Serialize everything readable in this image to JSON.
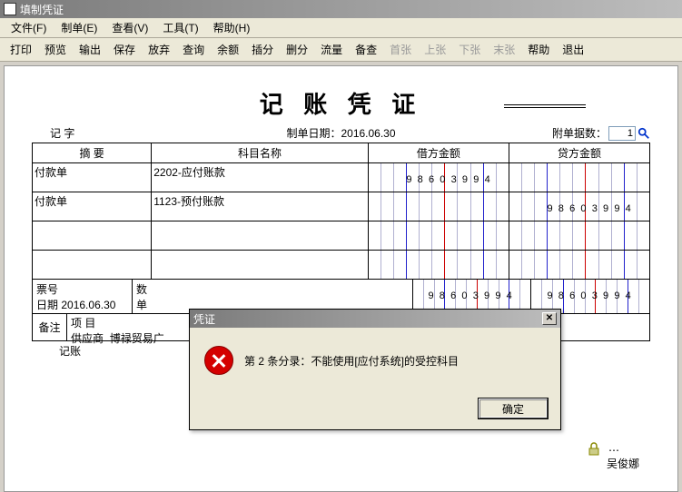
{
  "title": "填制凭证",
  "menubar": [
    "文件(F)",
    "制单(E)",
    "查看(V)",
    "工具(T)",
    "帮助(H)"
  ],
  "toolbar": {
    "items": [
      "打印",
      "预览",
      "输出",
      "保存",
      "放弃",
      "查询",
      "余额",
      "插分",
      "删分",
      "流量",
      "备查"
    ],
    "disabled": [
      "首张",
      "上张",
      "下张",
      "末张"
    ],
    "tail": [
      "帮助",
      "退出"
    ]
  },
  "doc": {
    "title": "记 账 凭 证",
    "type_label": "记      字",
    "date_label": "制单日期：",
    "date": "2016.06.30",
    "att_label": "附单据数：",
    "att_value": "1"
  },
  "columns": {
    "summary": "摘 要",
    "subject": "科目名称",
    "debit": "借方金额",
    "credit": "贷方金额"
  },
  "rows": [
    {
      "summary": "付款单",
      "subject": "2202-应付账款",
      "debit": "98603994",
      "credit": ""
    },
    {
      "summary": "付款单",
      "subject": "1123-预付账款",
      "debit": "",
      "credit": "98603994"
    },
    {
      "summary": "",
      "subject": "",
      "debit": "",
      "credit": ""
    },
    {
      "summary": "",
      "subject": "",
      "debit": "",
      "credit": ""
    }
  ],
  "footer": {
    "bill_no_label": "票号",
    "date_label": "日期",
    "date": "2016.06.30",
    "qty_label": "数",
    "price_label": "单",
    "debit_total": "98603994",
    "credit_total": "98603994",
    "remark_label": "备注",
    "project_label": "项 目",
    "supplier_label": "供应商",
    "supplier": "博禄贸易广",
    "journal_label": "记账",
    "reviewer": "吴俊娜"
  },
  "dialog": {
    "title": "凭证",
    "message": "第 2 条分录：不能使用[应付系统]的受控科目",
    "ok": "确定"
  }
}
